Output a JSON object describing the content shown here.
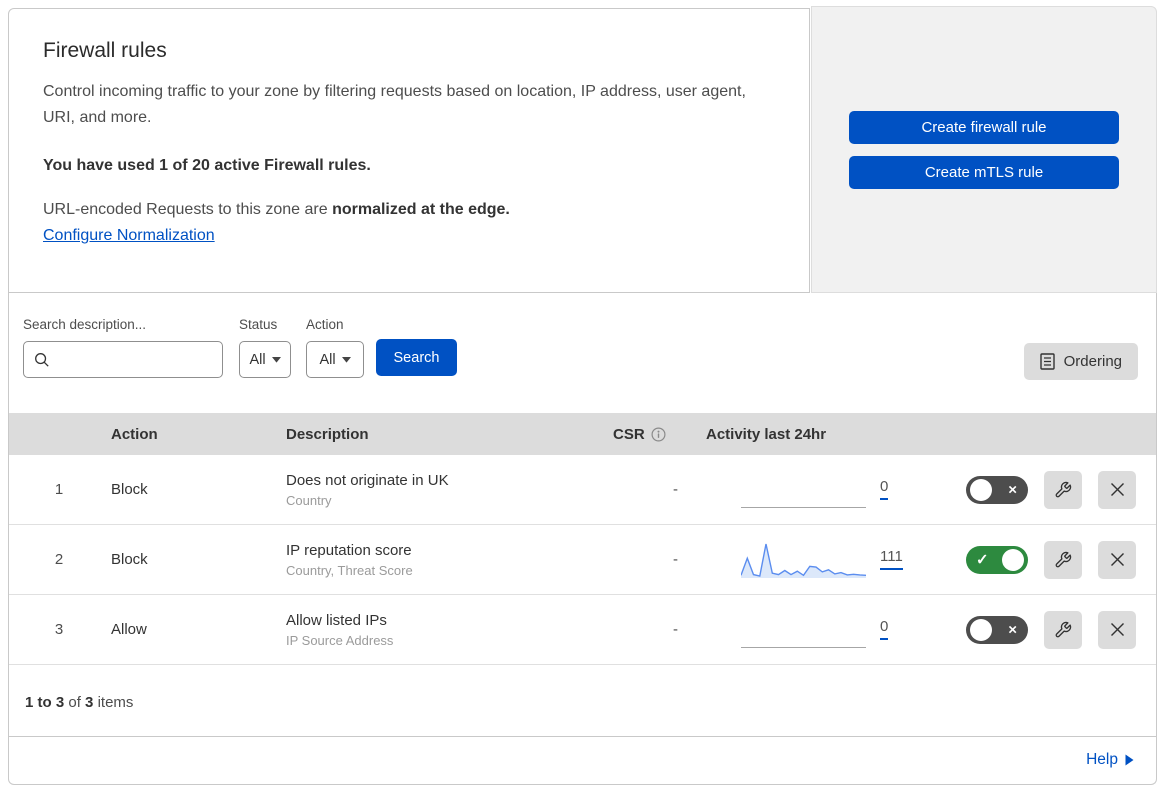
{
  "intro": {
    "title": "Firewall rules",
    "description": "Control incoming traffic to your zone by filtering requests based on location, IP address, user agent, URI, and more.",
    "usage": "You have used 1 of 20 active Firewall rules.",
    "normalization_prefix": "URL-encoded Requests to this zone are ",
    "normalization_bold": "normalized at the edge.",
    "normalization_link": "Configure Normalization"
  },
  "actions_panel": {
    "create_firewall_label": "Create firewall rule",
    "create_mtls_label": "Create mTLS rule"
  },
  "filters": {
    "search_label": "Search description...",
    "status_label": "Status",
    "status_value": "All",
    "action_label": "Action",
    "action_value": "All",
    "search_button_label": "Search",
    "ordering_label": "Ordering"
  },
  "table": {
    "columns": {
      "action": "Action",
      "description": "Description",
      "csr": "CSR",
      "activity": "Activity last 24hr"
    },
    "rows": [
      {
        "priority": "1",
        "action": "Block",
        "description": "Does not originate in UK",
        "fields": "Country",
        "csr": "-",
        "activity_count": "0",
        "enabled": false,
        "sparkline": []
      },
      {
        "priority": "2",
        "action": "Block",
        "description": "IP reputation score",
        "fields": "Country, Threat Score",
        "csr": "-",
        "activity_count": "111",
        "enabled": true,
        "sparkline": [
          8,
          58,
          10,
          6,
          100,
          14,
          10,
          22,
          10,
          20,
          8,
          34,
          32,
          18,
          24,
          12,
          16,
          9,
          11,
          9,
          8
        ]
      },
      {
        "priority": "3",
        "action": "Allow",
        "description": "Allow listed IPs",
        "fields": "IP Source Address",
        "csr": "-",
        "activity_count": "0",
        "enabled": false,
        "sparkline": []
      }
    ]
  },
  "footer": {
    "range": "1 to 3",
    "of": "of",
    "total": "3",
    "items": "items"
  },
  "help": {
    "label": "Help"
  },
  "icons": {
    "toggle_on_mark": "✓",
    "toggle_off_mark": "×"
  },
  "colors": {
    "accent_blue": "#0051c3",
    "toggle_on_green": "#2d8a3f",
    "toggle_off_gray": "#4d4d4d",
    "panel_gray": "#f1f1f1",
    "table_header_gray": "#dcdcdc",
    "sparkline_blue": "#5b8def"
  }
}
